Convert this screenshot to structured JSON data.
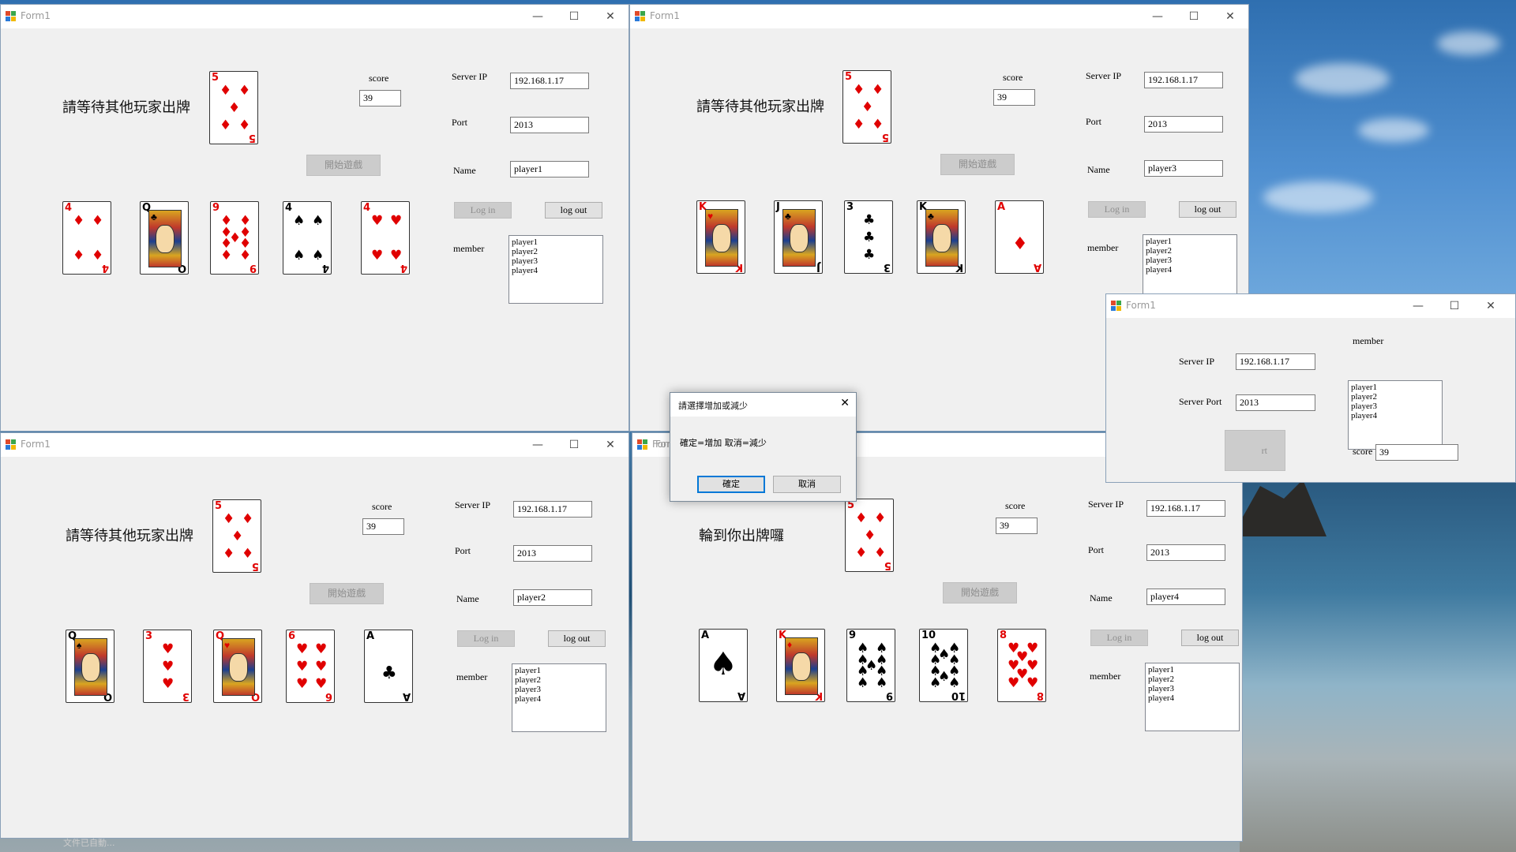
{
  "windows": {
    "w1": {
      "title": "Form1",
      "status": "請等待其他玩家出牌",
      "score_label": "score",
      "score": "39",
      "server_ip_label": "Server IP",
      "server_ip": "192.168.1.17",
      "port_label": "Port",
      "port": "2013",
      "name_label": "Name",
      "name": "player1",
      "start_button": "開始遊戲",
      "login_button": "Log in",
      "logout_button": "log out",
      "member_label": "member",
      "members": "player1\nplayer2\nplayer3\nplayer4",
      "center_card": {
        "rank": "5",
        "suit": "♦",
        "color": "red"
      },
      "hand": [
        {
          "rank": "4",
          "suit": "♦",
          "color": "red",
          "face": false
        },
        {
          "rank": "Q",
          "suit": "♣",
          "color": "blk",
          "face": true
        },
        {
          "rank": "9",
          "suit": "♦",
          "color": "red",
          "face": false
        },
        {
          "rank": "4",
          "suit": "♠",
          "color": "blk",
          "face": false
        },
        {
          "rank": "4",
          "suit": "♥",
          "color": "red",
          "face": false
        }
      ]
    },
    "w2": {
      "title": "Form1",
      "status": "請等待其他玩家出牌",
      "score_label": "score",
      "score": "39",
      "server_ip_label": "Server IP",
      "server_ip": "192.168.1.17",
      "port_label": "Port",
      "port": "2013",
      "name_label": "Name",
      "name": "player3",
      "start_button": "開始遊戲",
      "login_button": "Log in",
      "logout_button": "log out",
      "member_label": "member",
      "members": "player1\nplayer2\nplayer3\nplayer4",
      "center_card": {
        "rank": "5",
        "suit": "♦",
        "color": "red"
      },
      "hand": [
        {
          "rank": "K",
          "suit": "♥",
          "color": "red",
          "face": true
        },
        {
          "rank": "J",
          "suit": "♣",
          "color": "blk",
          "face": true
        },
        {
          "rank": "3",
          "suit": "♣",
          "color": "blk",
          "face": false
        },
        {
          "rank": "K",
          "suit": "♣",
          "color": "blk",
          "face": true
        },
        {
          "rank": "A",
          "suit": "♦",
          "color": "red",
          "face": false
        }
      ]
    },
    "w3": {
      "title": "Form1",
      "status": "請等待其他玩家出牌",
      "score_label": "score",
      "score": "39",
      "server_ip_label": "Server IP",
      "server_ip": "192.168.1.17",
      "port_label": "Port",
      "port": "2013",
      "name_label": "Name",
      "name": "player2",
      "start_button": "開始遊戲",
      "login_button": "Log in",
      "logout_button": "log out",
      "member_label": "member",
      "members": "player1\nplayer2\nplayer3\nplayer4",
      "center_card": {
        "rank": "5",
        "suit": "♦",
        "color": "red"
      },
      "hand": [
        {
          "rank": "Q",
          "suit": "♠",
          "color": "blk",
          "face": true
        },
        {
          "rank": "3",
          "suit": "♥",
          "color": "red",
          "face": false
        },
        {
          "rank": "Q",
          "suit": "♥",
          "color": "red",
          "face": true
        },
        {
          "rank": "6",
          "suit": "♥",
          "color": "red",
          "face": false
        },
        {
          "rank": "A",
          "suit": "♣",
          "color": "blk",
          "face": false
        }
      ]
    },
    "w4": {
      "title": "Form1",
      "status": "輪到你出牌囉",
      "score_label": "score",
      "score": "39",
      "server_ip_label": "Server IP",
      "server_ip": "192.168.1.17",
      "port_label": "Port",
      "port": "2013",
      "name_label": "Name",
      "name": "player4",
      "start_button": "開始遊戲",
      "login_button": "Log in",
      "logout_button": "log out",
      "member_label": "member",
      "members": "player1\nplayer2\nplayer3\nplayer4",
      "center_card": {
        "rank": "5",
        "suit": "♦",
        "color": "red"
      },
      "hand": [
        {
          "rank": "A",
          "suit": "♠",
          "color": "blk",
          "face": false
        },
        {
          "rank": "K",
          "suit": "♦",
          "color": "red",
          "face": true
        },
        {
          "rank": "9",
          "suit": "♠",
          "color": "blk",
          "face": false
        },
        {
          "rank": "10",
          "suit": "♠",
          "color": "blk",
          "face": false
        },
        {
          "rank": "8",
          "suit": "♥",
          "color": "red",
          "face": false
        }
      ]
    },
    "server": {
      "title": "Form1",
      "member_label": "member",
      "members": "player1\nplayer2\nplayer3\nplayer4",
      "server_ip_label": "Server IP",
      "server_ip": "192.168.1.17",
      "server_port_label": "Server Port",
      "server_port": "2013",
      "score_label": "score",
      "score": "39",
      "button_partial": "rt"
    }
  },
  "dialog": {
    "title": "請選擇增加或減少",
    "message": "確定=增加 取消=減少",
    "ok_button": "確定",
    "cancel_button": "取消"
  },
  "hidden_titles": {
    "w4_partial": "For"
  },
  "taskbar_text": "文件已自動..."
}
